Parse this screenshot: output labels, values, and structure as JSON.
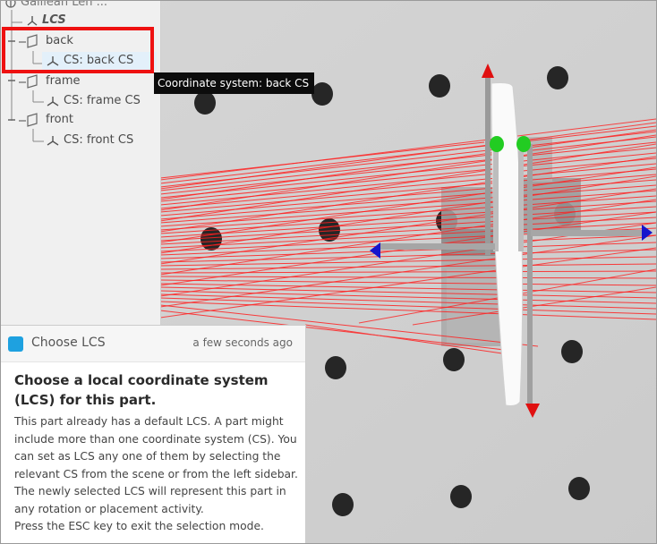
{
  "sidebar": {
    "root_label": "Galilean Len ...",
    "lcs_label": "LCS",
    "items": [
      {
        "label": "back",
        "child": "CS: back CS"
      },
      {
        "label": "frame",
        "child": "CS: frame CS"
      },
      {
        "label": "front",
        "child": "CS: front CS"
      }
    ]
  },
  "tooltip": "Coordinate system: back CS",
  "notification": {
    "title": "Choose LCS",
    "time": "a few seconds ago",
    "heading": "Choose a local coordinate system (LCS) for this part.",
    "body": [
      "This part already has a default LCS. A part might include more than one coordinate system (CS). You can set as LCS any one of them by selecting the relevant CS from the scene or from the left sidebar.",
      "The newly selected LCS will represent this part in any rotation or placement activity.",
      "Press the ESC key to exit the selection mode."
    ]
  },
  "colors": {
    "accent": "#1ea1e0",
    "highlight": "#ee1111",
    "ray": "#ff1a1a",
    "axis_x": "#1515cc",
    "axis_y": "#e01010",
    "point": "#22cc22"
  },
  "icons": {
    "tree_part": "part-icon",
    "tree_cs": "coordinate-system-icon"
  }
}
